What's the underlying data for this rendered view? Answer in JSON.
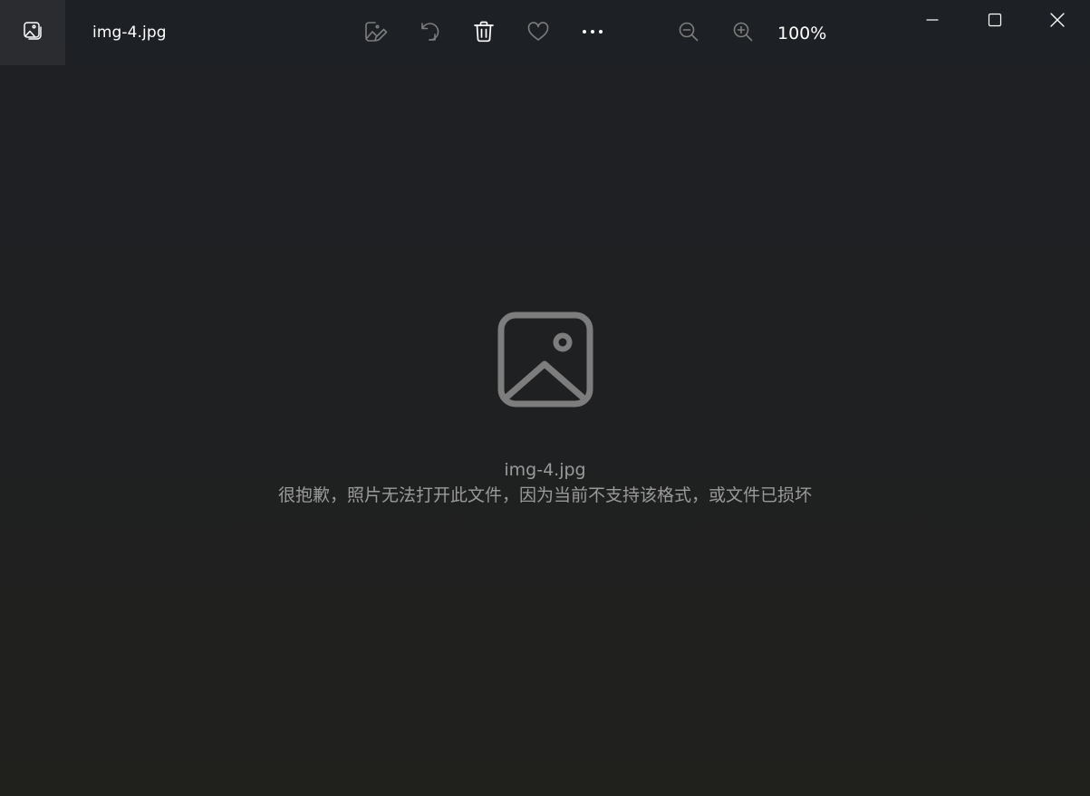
{
  "titlebar": {
    "app_icon": "photos-app-icon",
    "file_title": "img-4.jpg",
    "tools": [
      {
        "name": "edit-image-icon"
      },
      {
        "name": "rotate-icon"
      },
      {
        "name": "delete-icon"
      },
      {
        "name": "favorite-heart-icon"
      },
      {
        "name": "more-options-icon"
      }
    ],
    "zoom_out_icon": "zoom-out-icon",
    "zoom_in_icon": "zoom-in-icon",
    "zoom_level": "100%",
    "window_controls": {
      "minimize": "minimize-icon",
      "maximize": "maximize-icon",
      "close": "close-icon"
    }
  },
  "main": {
    "placeholder_icon": "image-placeholder-icon",
    "file_name": "img-4.jpg",
    "error_message": "很抱歉，照片无法打开此文件，因为当前不支持该格式，或文件已损坏"
  },
  "colors": {
    "background": "#1e1f20",
    "title_text": "#ffffff",
    "muted_text": "#9a9a9a",
    "icon_disabled": "#7d7d7d",
    "icon_active": "#ffffff"
  }
}
